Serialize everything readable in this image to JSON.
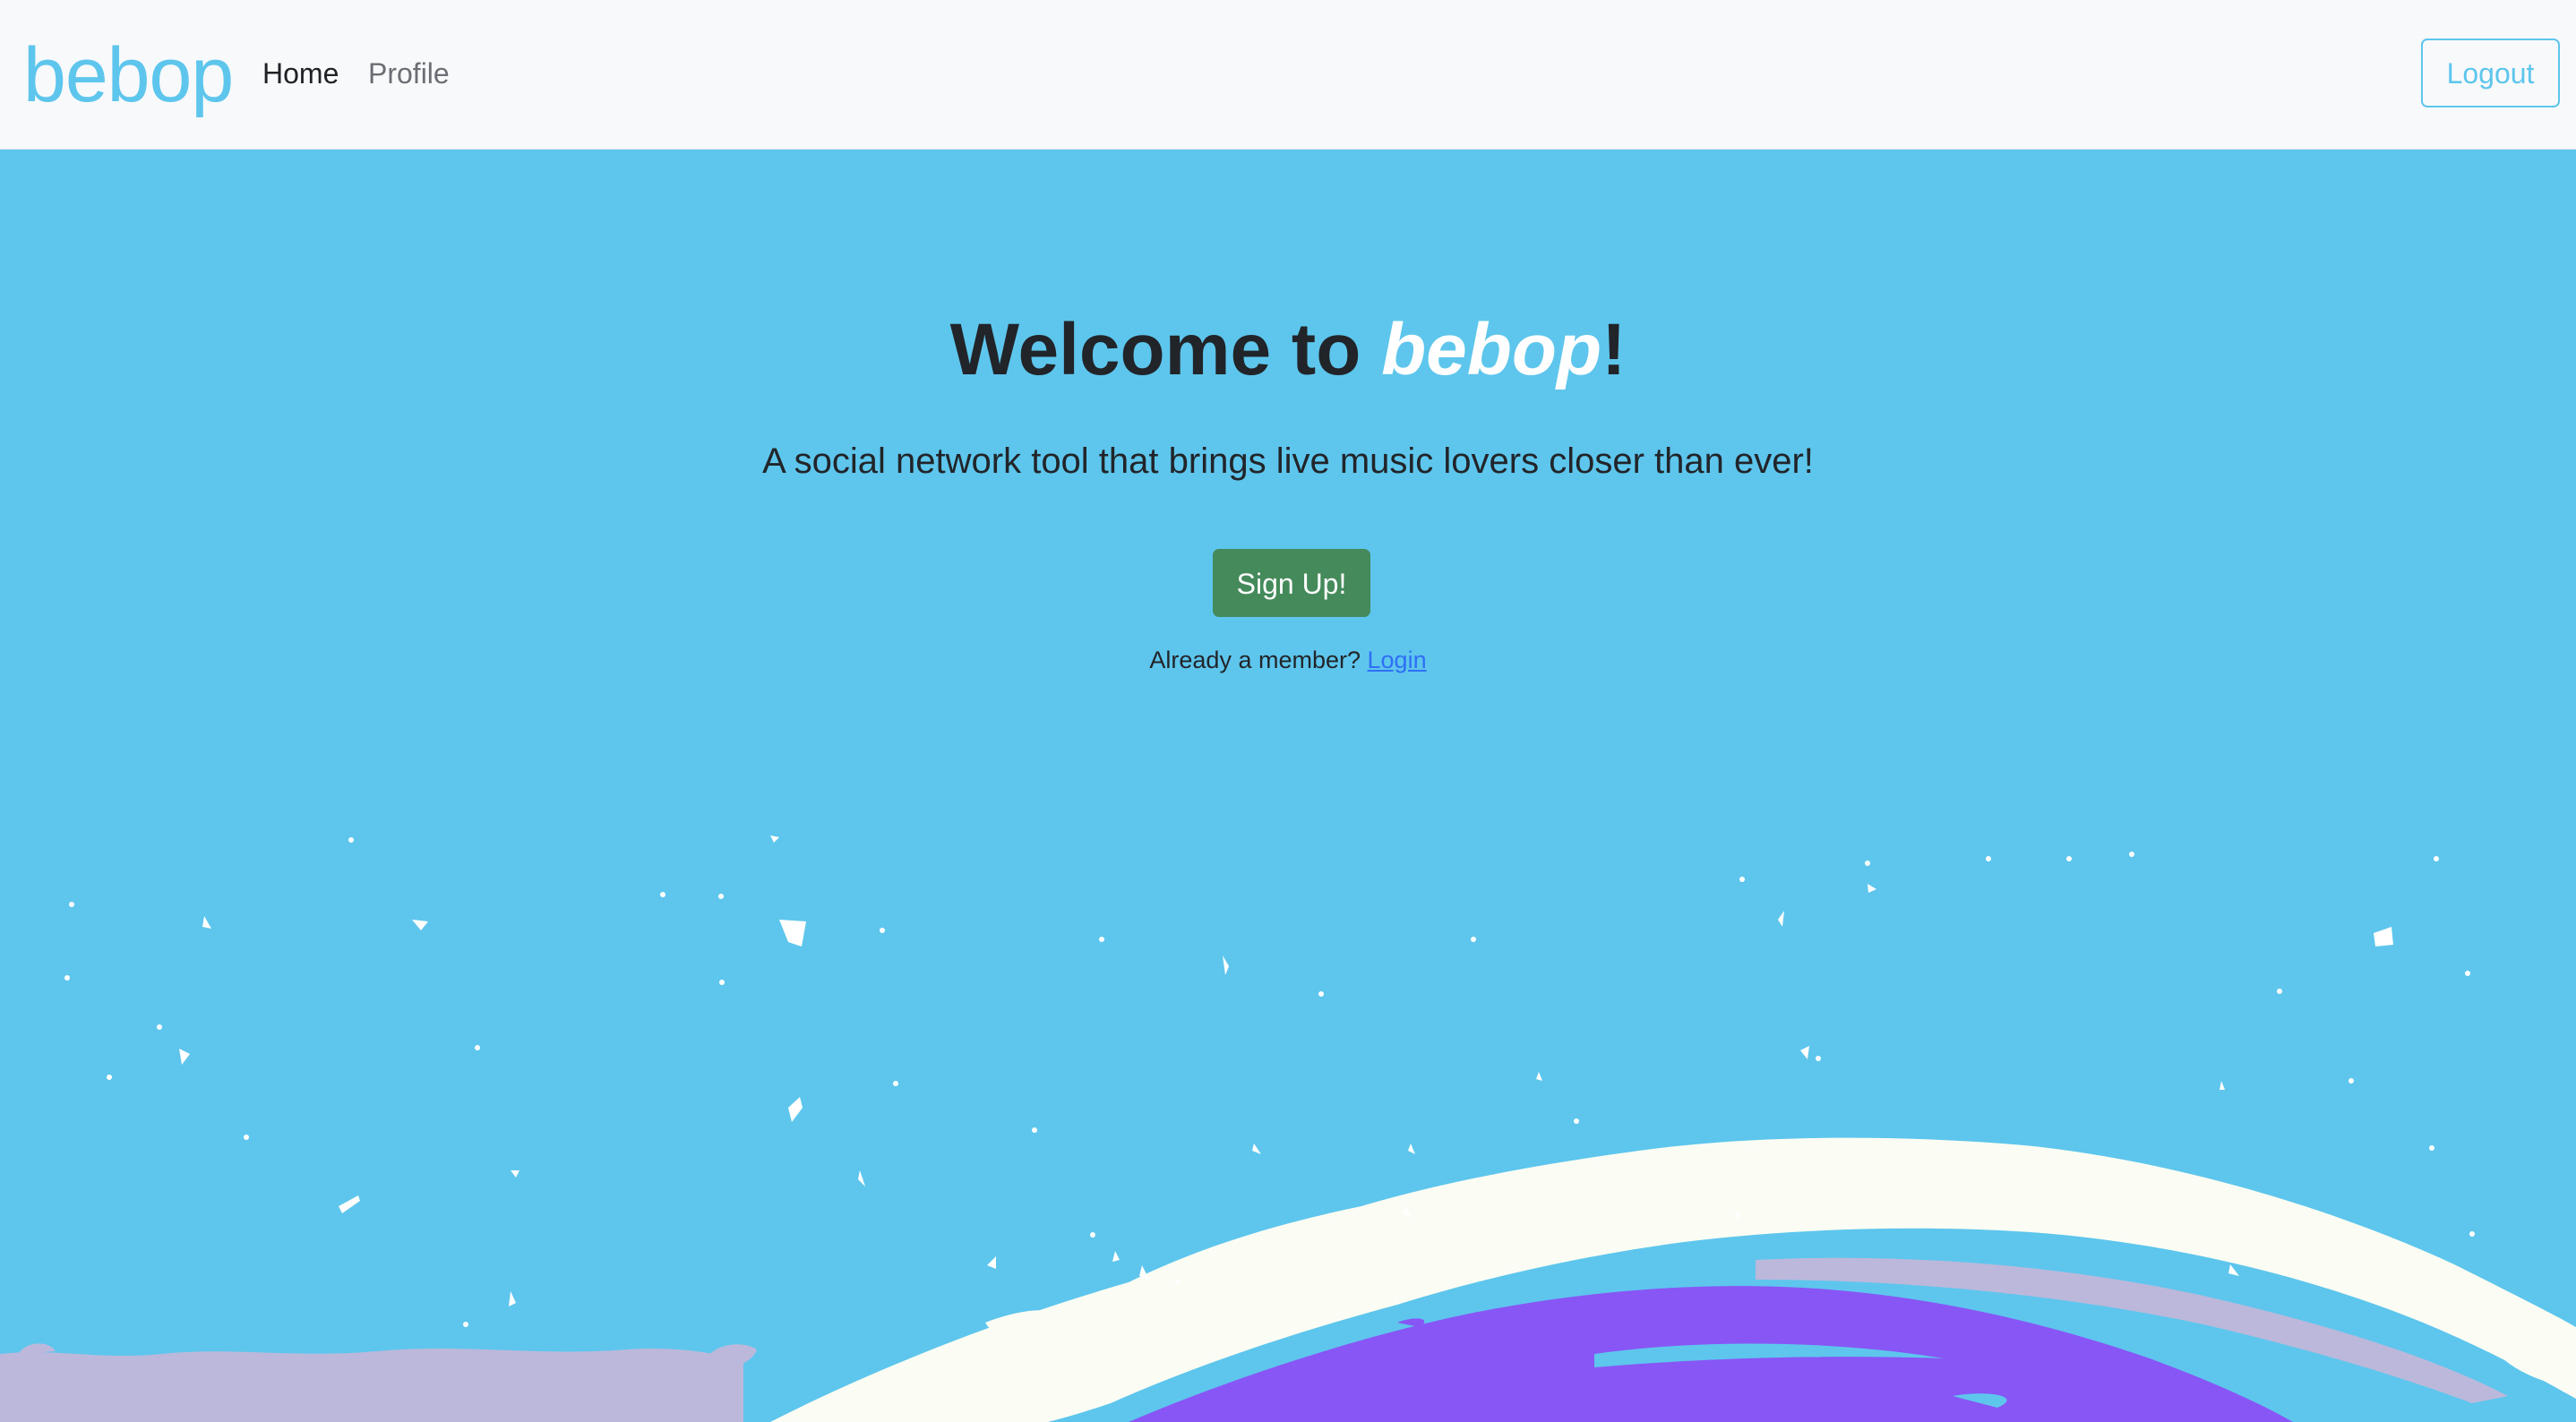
{
  "navbar": {
    "brand": "bebop",
    "links": [
      {
        "label": "Home",
        "active": true
      },
      {
        "label": "Profile",
        "active": false
      }
    ],
    "logout_label": "Logout"
  },
  "hero": {
    "title_prefix": "Welcome to ",
    "title_brand": "bebop",
    "title_suffix": "!",
    "lead": "A social network tool that brings live music lovers closer than ever!",
    "signup_label": "Sign Up!",
    "member_prompt": "Already a member?",
    "login_label": "Login"
  },
  "colors": {
    "accent": "#5ec6ec",
    "navbar_bg": "#f8f9fb",
    "signup_green": "#458a5b",
    "link_blue": "#2f6ff5",
    "art_white": "#fbfdf4",
    "art_purple": "#8856f5",
    "art_lavender": "#bbb8dc"
  }
}
